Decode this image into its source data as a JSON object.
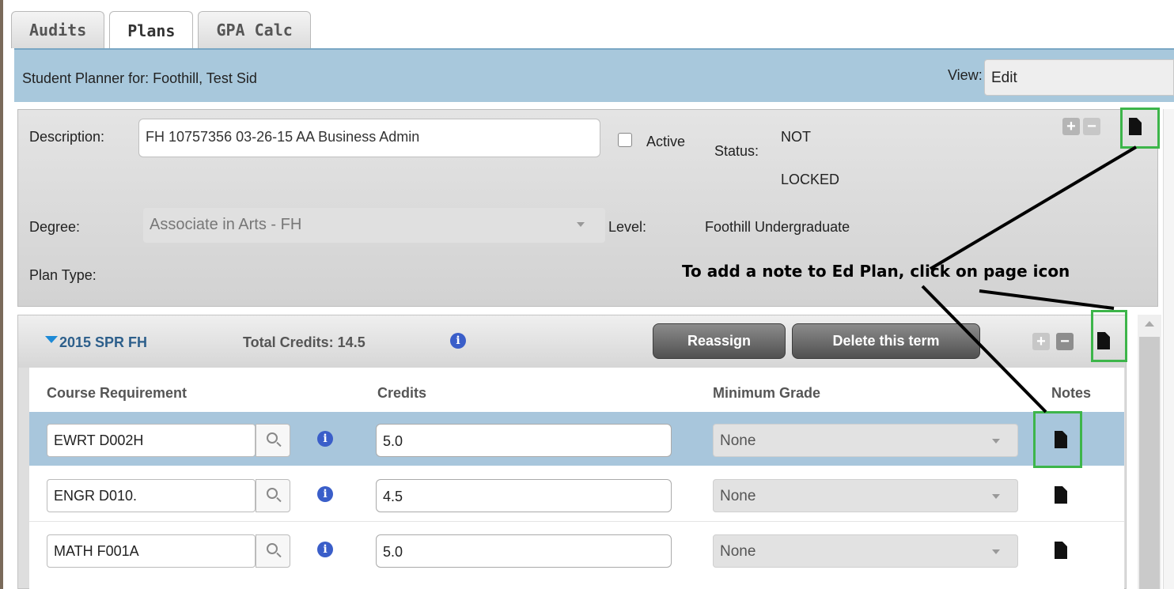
{
  "tabs": [
    {
      "label": "Audits",
      "active": false
    },
    {
      "label": "Plans",
      "active": true
    },
    {
      "label": "GPA Calc",
      "active": false
    }
  ],
  "header": {
    "title": "Student Planner for: Foothill, Test Sid",
    "view_label": "View:",
    "view_value": "Edit"
  },
  "plan": {
    "description_label": "Description:",
    "description_value": "FH 10757356 03-26-15 AA Business Admin",
    "active_label": "Active",
    "active_checked": false,
    "status_label": "Status:",
    "status_value_line1": "NOT",
    "status_value_line2": "LOCKED",
    "degree_label": "Degree:",
    "degree_value": "Associate in Arts - FH",
    "level_label": "Level:",
    "level_value": "Foothill Undergraduate",
    "plan_type_label": "Plan Type:",
    "add_symbol": "+",
    "remove_symbol": "−"
  },
  "annotation": "To add a note to Ed Plan, click on page icon",
  "term": {
    "title": "2015 SPR FH",
    "total_credits_label": "Total Credits: 14.5",
    "info_symbol": "i",
    "reassign_label": "Reassign",
    "delete_label": "Delete this term",
    "add_symbol": "+",
    "remove_symbol": "−",
    "columns": [
      "Course Requirement",
      "Credits",
      "Minimum Grade",
      "Notes"
    ],
    "rows": [
      {
        "course": "EWRT D002H",
        "credits": "5.0",
        "grade": "None",
        "selected": true
      },
      {
        "course": "ENGR D010.",
        "credits": "4.5",
        "grade": "None",
        "selected": false
      },
      {
        "course": "MATH F001A",
        "credits": "5.0",
        "grade": "None",
        "selected": false
      }
    ]
  },
  "colors": {
    "header_bg": "#a8c8dc",
    "selected_row": "#a8c6dc",
    "highlight_box": "#3db54a",
    "info_icon": "#3a5ec9",
    "term_title": "#2d5f8b"
  }
}
